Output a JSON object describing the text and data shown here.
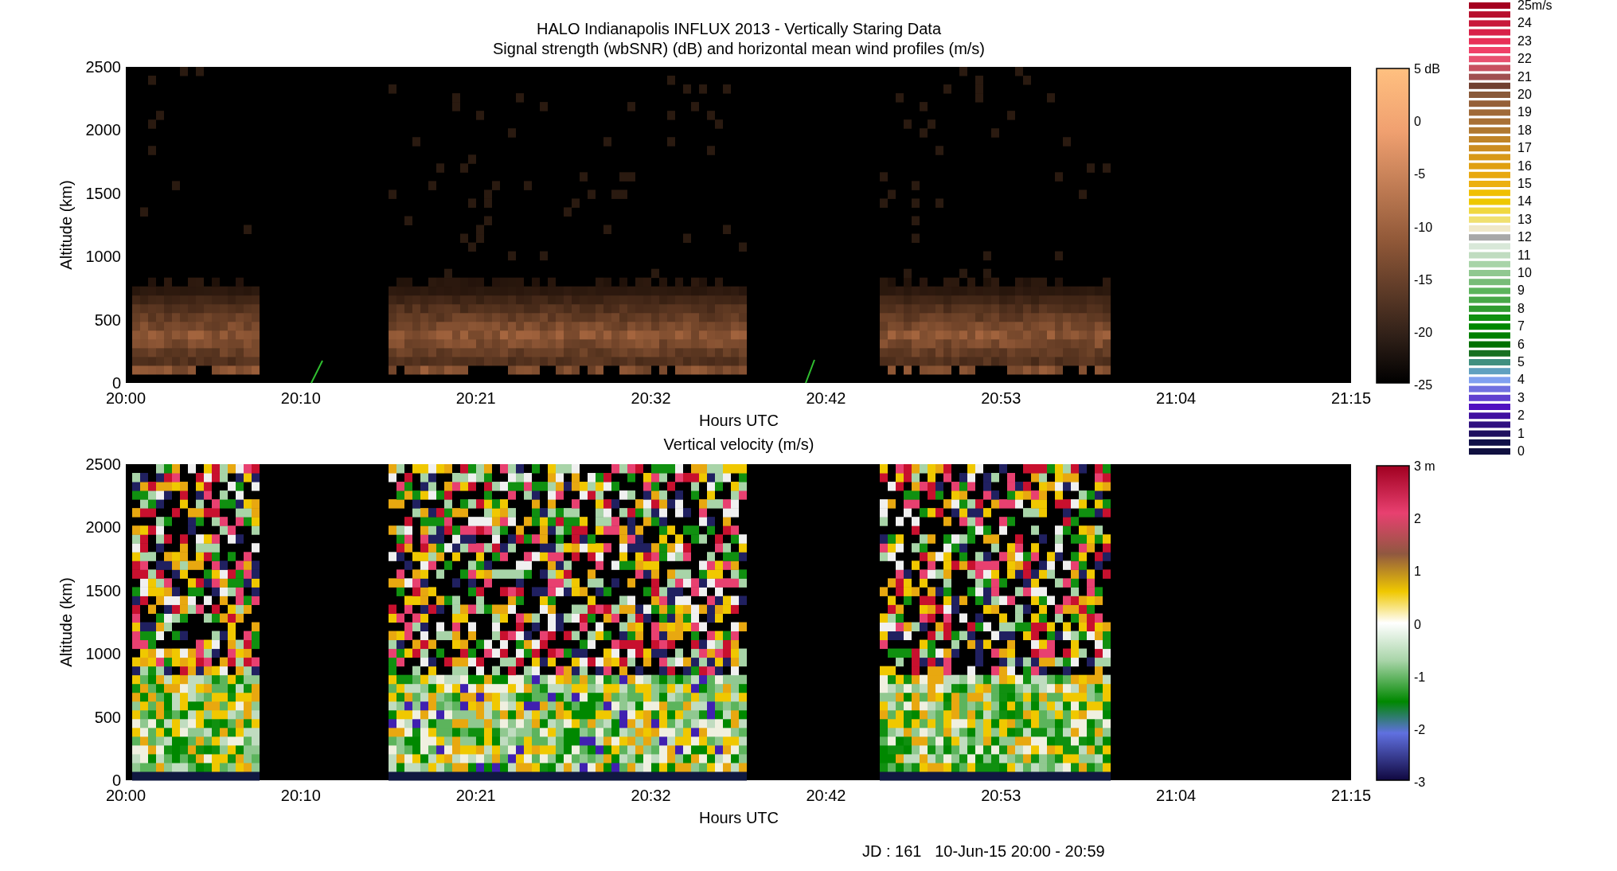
{
  "title": {
    "line_1": "HALO Indianapolis INFLUX 2013 - Vertically Staring Data",
    "line_2": "Signal strength (wbSNR) (dB) and horizontal mean wind profiles (m/s)"
  },
  "panels": [
    {
      "kind": "snr",
      "ylabel": "Altitude (km)",
      "xlabel": "Hours UTC",
      "yticks": [
        "2500",
        "2000",
        "1500",
        "1000",
        "500",
        "0"
      ],
      "xticks": [
        "20:00",
        "20:10",
        "20:21",
        "20:32",
        "20:42",
        "20:53",
        "21:04",
        "21:15"
      ],
      "colorbar_labels": [
        "5 dB",
        "0",
        "-5",
        "-10",
        "-15",
        "-20",
        "-25"
      ]
    },
    {
      "kind": "velocity",
      "title": "Vertical velocity (m/s)",
      "ylabel": "Altitude (km)",
      "xlabel": "Hours UTC",
      "yticks": [
        "2500",
        "2000",
        "1500",
        "1000",
        "500",
        "0"
      ],
      "xticks": [
        "20:00",
        "20:10",
        "20:21",
        "20:32",
        "20:42",
        "20:53",
        "21:04",
        "21:15"
      ],
      "colorbar_labels": [
        "3 m",
        "2",
        "1",
        "0",
        "-1",
        "-2",
        "-3"
      ]
    }
  ],
  "wind_scale": {
    "labels": [
      "25m/s",
      "24",
      "23",
      "22",
      "21",
      "20",
      "19",
      "18",
      "17",
      "16",
      "15",
      "14",
      "13",
      "12",
      "11",
      "10",
      "9",
      "8",
      "7",
      "6",
      "5",
      "4",
      "3",
      "2",
      "1",
      "0"
    ],
    "swatches": [
      {
        "color": "#a50020"
      },
      {
        "color": "#b8102e"
      },
      {
        "color": "#c8183a"
      },
      {
        "color": "#d82048"
      },
      {
        "color": "#e83058"
      },
      {
        "color": "#f04068"
      },
      {
        "color": "#e85070"
      },
      {
        "color": "#c85060"
      },
      {
        "color": "#a05050"
      },
      {
        "color": "#704030"
      },
      {
        "color": "#8a5a3a"
      },
      {
        "color": "#956038"
      },
      {
        "color": "#a06a38"
      },
      {
        "color": "#a87035"
      },
      {
        "color": "#b07830"
      },
      {
        "color": "#c08428"
      },
      {
        "color": "#cc8c20"
      },
      {
        "color": "#d89818"
      },
      {
        "color": "#e0a010"
      },
      {
        "color": "#e8a810"
      },
      {
        "color": "#ecb010"
      },
      {
        "color": "#f0c000"
      },
      {
        "color": "#eec800"
      },
      {
        "color": "#f0d840"
      },
      {
        "color": "#f0e070"
      },
      {
        "color": "#f0e8c8"
      },
      {
        "color": "#a8a8a8"
      },
      {
        "color": "#d8e8d8"
      },
      {
        "color": "#c0dcc0"
      },
      {
        "color": "#a8d4a8"
      },
      {
        "color": "#90c890"
      },
      {
        "color": "#78bc78"
      },
      {
        "color": "#5cb45c"
      },
      {
        "color": "#48a848"
      },
      {
        "color": "#309c30"
      },
      {
        "color": "#109010"
      },
      {
        "color": "#008800"
      },
      {
        "color": "#008000"
      },
      {
        "color": "#007000"
      },
      {
        "color": "#187020"
      },
      {
        "color": "#409080"
      },
      {
        "color": "#60a0c0"
      },
      {
        "color": "#80a0f0"
      },
      {
        "color": "#7070e0"
      },
      {
        "color": "#6040d0"
      },
      {
        "color": "#5010c0"
      },
      {
        "color": "#4010a0"
      },
      {
        "color": "#301080"
      },
      {
        "color": "#201060"
      },
      {
        "color": "#101048"
      },
      {
        "color": "#101040"
      }
    ]
  },
  "footer": "JD : 161   10-Jun-15 20:00 - 20:59"
}
